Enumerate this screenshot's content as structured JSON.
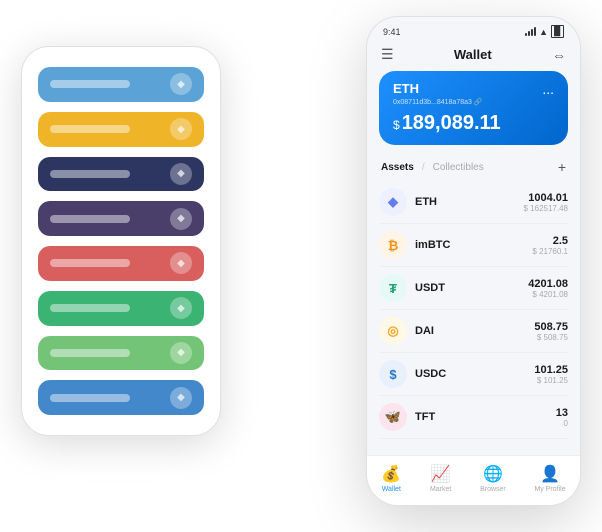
{
  "left_phone": {
    "cards": [
      {
        "color": "#5ba3d6",
        "label": "card-1"
      },
      {
        "color": "#f0b429",
        "label": "card-2"
      },
      {
        "color": "#2d3561",
        "label": "card-3"
      },
      {
        "color": "#4a3f6b",
        "label": "card-4"
      },
      {
        "color": "#d95f5f",
        "label": "card-5"
      },
      {
        "color": "#3bb373",
        "label": "card-6"
      },
      {
        "color": "#74c478",
        "label": "card-7"
      },
      {
        "color": "#4488cc",
        "label": "card-8"
      }
    ]
  },
  "right_phone": {
    "status_bar": {
      "time": "9:41"
    },
    "header": {
      "title": "Wallet",
      "menu_icon": "☰",
      "expand_icon": "⇔"
    },
    "eth_card": {
      "name": "ETH",
      "address": "0x08711d3b...8418a78a3",
      "address_suffix": "🔗",
      "dots": "...",
      "currency_symbol": "$",
      "balance": "189,089.11"
    },
    "assets_section": {
      "tab_active": "Assets",
      "tab_divider": "/",
      "tab_inactive": "Collectibles",
      "add_icon": "+"
    },
    "assets": [
      {
        "name": "ETH",
        "icon_char": "◆",
        "icon_color": "#627eea",
        "icon_bg": "#eef0ff",
        "amount": "1004.01",
        "usd": "$ 162517.48"
      },
      {
        "name": "imBTC",
        "icon_char": "₿",
        "icon_color": "#f7931a",
        "icon_bg": "#fff4e6",
        "amount": "2.5",
        "usd": "$ 21760.1"
      },
      {
        "name": "USDT",
        "icon_char": "₮",
        "icon_color": "#26a17b",
        "icon_bg": "#e6f9f4",
        "amount": "4201.08",
        "usd": "$ 4201.08"
      },
      {
        "name": "DAI",
        "icon_char": "◎",
        "icon_color": "#f5a623",
        "icon_bg": "#fff8e6",
        "amount": "508.75",
        "usd": "$ 508.75"
      },
      {
        "name": "USDC",
        "icon_char": "$",
        "icon_color": "#2775ca",
        "icon_bg": "#e8f1fb",
        "amount": "101.25",
        "usd": "$ 101.25"
      },
      {
        "name": "TFT",
        "icon_char": "🦋",
        "icon_color": "#e91e63",
        "icon_bg": "#fce4ec",
        "amount": "13",
        "usd": "0"
      }
    ],
    "bottom_nav": [
      {
        "label": "Wallet",
        "icon": "💰",
        "active": true
      },
      {
        "label": "Market",
        "icon": "📈",
        "active": false
      },
      {
        "label": "Browser",
        "icon": "🌐",
        "active": false
      },
      {
        "label": "My Profile",
        "icon": "👤",
        "active": false
      }
    ]
  }
}
